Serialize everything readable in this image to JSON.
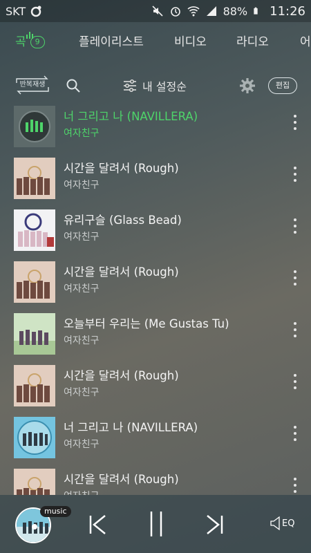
{
  "status": {
    "carrier": "SKT",
    "battery": "88%",
    "time": "11:26"
  },
  "tabs": [
    {
      "label": "곡",
      "badge": "9",
      "active": true
    },
    {
      "label": "플레이리스트"
    },
    {
      "label": "비디오"
    },
    {
      "label": "라디오"
    },
    {
      "label": "어"
    }
  ],
  "toolbar": {
    "repeat_label": "반복재생",
    "sort_label": "내 설정순",
    "edit_label": "편집"
  },
  "songs": [
    {
      "title": "너 그리고 나 (NAVILLERA)",
      "artist": "여자친구",
      "playing": true,
      "art": "navillera-dark"
    },
    {
      "title": "시간을 달려서 (Rough)",
      "artist": "여자친구",
      "art": "rough"
    },
    {
      "title": "유리구슬 (Glass Bead)",
      "artist": "여자친구",
      "art": "glassbead"
    },
    {
      "title": "시간을 달려서 (Rough)",
      "artist": "여자친구",
      "art": "rough"
    },
    {
      "title": "오늘부터 우리는 (Me Gustas Tu)",
      "artist": "여자친구",
      "art": "megustas"
    },
    {
      "title": "시간을 달려서 (Rough)",
      "artist": "여자친구",
      "art": "rough"
    },
    {
      "title": "너 그리고 나 (NAVILLERA)",
      "artist": "여자친구",
      "art": "navillera-blue"
    },
    {
      "title": "시간을 달려서 (Rough)",
      "artist": "여자친구",
      "art": "rough"
    }
  ],
  "player": {
    "chip_label": "music",
    "eq_label": "EQ"
  },
  "colors": {
    "accent": "#4ed46a"
  }
}
